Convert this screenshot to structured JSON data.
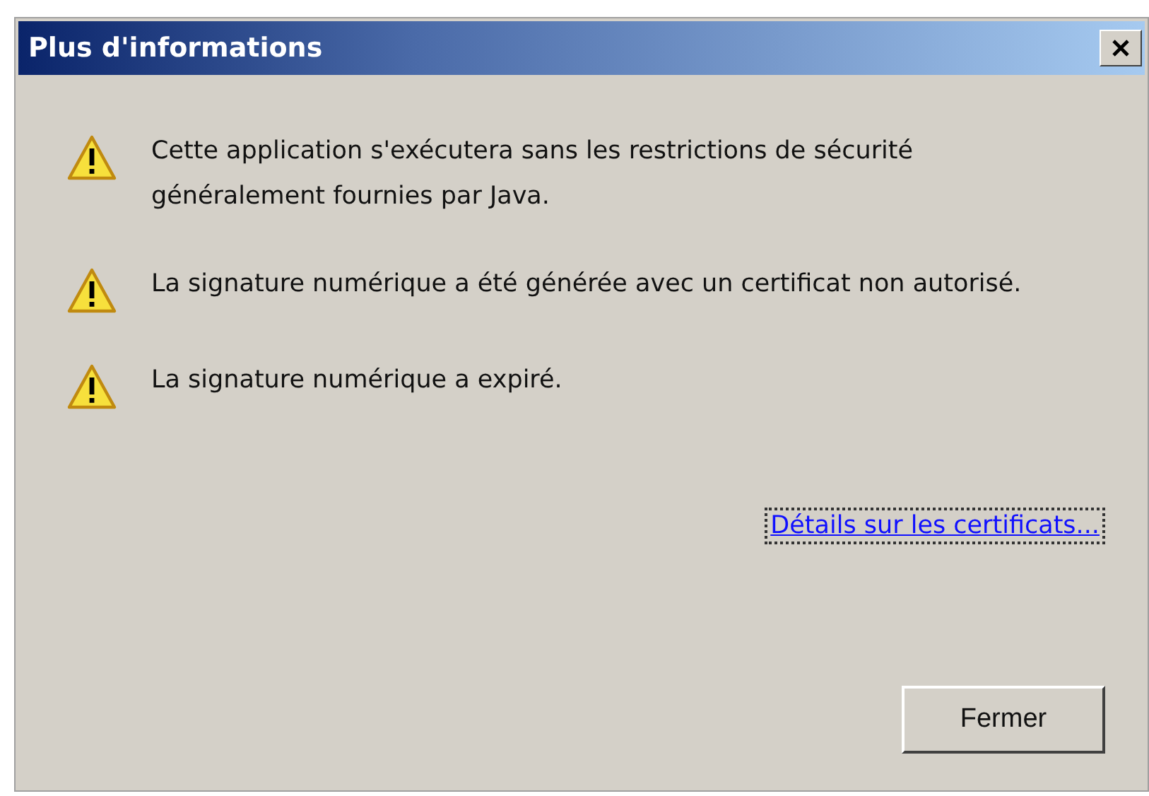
{
  "window": {
    "title": "Plus d'informations"
  },
  "messages": [
    {
      "text": "Cette application s'exécutera sans les restrictions de sécurité généralement fournies par Java."
    },
    {
      "text": "La signature numérique a été générée avec un certificat non autorisé."
    },
    {
      "text": "La signature numérique a expiré."
    }
  ],
  "link": {
    "label": "Détails sur les certificats...",
    "focused": true
  },
  "buttons": [
    "Fermer"
  ]
}
